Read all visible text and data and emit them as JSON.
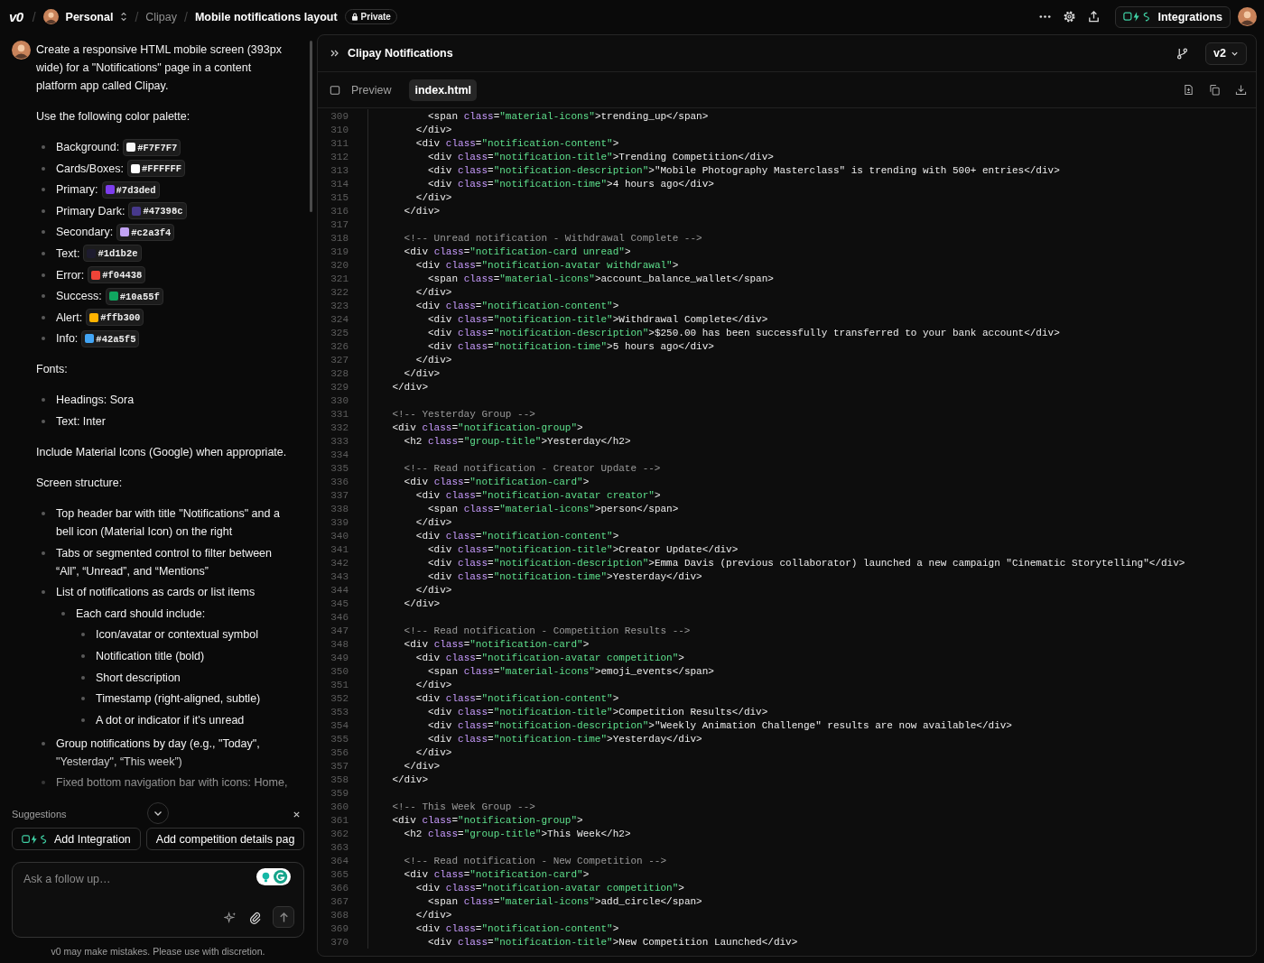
{
  "topbar": {
    "logo": "v0",
    "breadcrumbs": [
      {
        "kind": "account",
        "separator": "/",
        "label": "Personal"
      },
      {
        "kind": "project",
        "separator": "/",
        "label": "Clipay"
      },
      {
        "kind": "chat",
        "separator": "/",
        "label": "Mobile notifications layout"
      }
    ],
    "visibility": "Private",
    "integrations": "Integrations"
  },
  "prompt": {
    "intro": "Create a responsive HTML mobile screen (393px wide) for a \"Notifications\" page in a content platform app called Clipay.",
    "palette_heading": "Use the following color palette:",
    "palette": [
      {
        "label": "Background:",
        "value": "#F7F7F7",
        "color": "#f7f7f7"
      },
      {
        "label": "Cards/Boxes:",
        "value": "#FFFFFF",
        "color": "#ffffff"
      },
      {
        "label": "Primary:",
        "value": "#7d3ded",
        "color": "#7d3ded"
      },
      {
        "label": "Primary Dark:",
        "value": "#47398c",
        "color": "#47398c"
      },
      {
        "label": "Secondary:",
        "value": "#c2a3f4",
        "color": "#c2a3f4"
      },
      {
        "label": "Text:",
        "value": "#1d1b2e",
        "color": "#1d1b2e"
      },
      {
        "label": "Error:",
        "value": "#f04438",
        "color": "#f04438"
      },
      {
        "label": "Success:",
        "value": "#10a55f",
        "color": "#10a55f"
      },
      {
        "label": "Alert:",
        "value": "#ffb300",
        "color": "#ffb300"
      },
      {
        "label": "Info:",
        "value": "#42a5f5",
        "color": "#42a5f5"
      }
    ],
    "fonts_heading": "Fonts:",
    "fonts": [
      "Headings: Sora",
      "Text: Inter"
    ],
    "icons_note": "Include Material Icons (Google) when appropriate.",
    "structure_heading": "Screen structure:",
    "structure": [
      {
        "text": "Top header bar with title \"Notifications\" and a bell icon (Material Icon) on the right"
      },
      {
        "text": "Tabs or segmented control to filter between “All”, “Unread”, and “Mentions”"
      },
      {
        "text": "List of notifications as cards or list items",
        "children": [
          {
            "text": "Each card should include:",
            "children": [
              {
                "text": "Icon/avatar or contextual symbol"
              },
              {
                "text": "Notification title (bold)"
              },
              {
                "text": "Short description"
              },
              {
                "text": "Timestamp (right-aligned, subtle)"
              },
              {
                "text": "A dot or indicator if it's unread"
              }
            ]
          }
        ]
      },
      {
        "text": "Group notifications by day (e.g., \"Today\", \"Yesterday\", “This week”)"
      },
      {
        "text": "Fixed bottom navigation bar with icons: Home,"
      }
    ]
  },
  "suggestions": {
    "title": "Suggestions",
    "chips": [
      {
        "kind": "integration",
        "label": "Add Integration"
      },
      {
        "kind": "plain",
        "label": "Add competition details pag"
      }
    ]
  },
  "composer": {
    "placeholder": "Ask a follow up…"
  },
  "disclaimer": "v0 may make mistakes. Please use with discretion.",
  "editor": {
    "title": "Clipay Notifications",
    "version": "v2",
    "tabs": [
      {
        "kind": "preview",
        "label": "Preview",
        "selected": false
      },
      {
        "kind": "file",
        "label": "index.html",
        "selected": true
      }
    ],
    "lines": [
      {
        "n": "309",
        "parts": [
          {
            "kind": "p",
            "text": "          <span "
          },
          {
            "kind": "a",
            "text": "class"
          },
          {
            "kind": "p",
            "text": "="
          },
          {
            "kind": "s",
            "text": "\"material-icons\""
          },
          {
            "kind": "p",
            "text": ">trending_up</span>"
          }
        ]
      },
      {
        "n": "310",
        "parts": [
          {
            "kind": "p",
            "text": "        </div>"
          }
        ]
      },
      {
        "n": "311",
        "parts": [
          {
            "kind": "p",
            "text": "        <div "
          },
          {
            "kind": "a",
            "text": "class"
          },
          {
            "kind": "p",
            "text": "="
          },
          {
            "kind": "s",
            "text": "\"notification-content\""
          },
          {
            "kind": "p",
            "text": ">"
          }
        ]
      },
      {
        "n": "312",
        "parts": [
          {
            "kind": "p",
            "text": "          <div "
          },
          {
            "kind": "a",
            "text": "class"
          },
          {
            "kind": "p",
            "text": "="
          },
          {
            "kind": "s",
            "text": "\"notification-title\""
          },
          {
            "kind": "p",
            "text": ">Trending Competition</div>"
          }
        ]
      },
      {
        "n": "313",
        "parts": [
          {
            "kind": "p",
            "text": "          <div "
          },
          {
            "kind": "a",
            "text": "class"
          },
          {
            "kind": "p",
            "text": "="
          },
          {
            "kind": "s",
            "text": "\"notification-description\""
          },
          {
            "kind": "p",
            "text": ">\"Mobile Photography Masterclass\" is trending with 500+ entries</div>"
          }
        ]
      },
      {
        "n": "314",
        "parts": [
          {
            "kind": "p",
            "text": "          <div "
          },
          {
            "kind": "a",
            "text": "class"
          },
          {
            "kind": "p",
            "text": "="
          },
          {
            "kind": "s",
            "text": "\"notification-time\""
          },
          {
            "kind": "p",
            "text": ">4 hours ago</div>"
          }
        ]
      },
      {
        "n": "315",
        "parts": [
          {
            "kind": "p",
            "text": "        </div>"
          }
        ]
      },
      {
        "n": "316",
        "parts": [
          {
            "kind": "p",
            "text": "      </div>"
          }
        ]
      },
      {
        "n": "317"
      },
      {
        "n": "318",
        "parts": [
          {
            "kind": "c",
            "text": "      <!-- Unread notification - Withdrawal Complete -->"
          }
        ]
      },
      {
        "n": "319",
        "parts": [
          {
            "kind": "p",
            "text": "      <div "
          },
          {
            "kind": "a",
            "text": "class"
          },
          {
            "kind": "p",
            "text": "="
          },
          {
            "kind": "s",
            "text": "\"notification-card unread\""
          },
          {
            "kind": "p",
            "text": ">"
          }
        ]
      },
      {
        "n": "320",
        "parts": [
          {
            "kind": "p",
            "text": "        <div "
          },
          {
            "kind": "a",
            "text": "class"
          },
          {
            "kind": "p",
            "text": "="
          },
          {
            "kind": "s",
            "text": "\"notification-avatar withdrawal\""
          },
          {
            "kind": "p",
            "text": ">"
          }
        ]
      },
      {
        "n": "321",
        "parts": [
          {
            "kind": "p",
            "text": "          <span "
          },
          {
            "kind": "a",
            "text": "class"
          },
          {
            "kind": "p",
            "text": "="
          },
          {
            "kind": "s",
            "text": "\"material-icons\""
          },
          {
            "kind": "p",
            "text": ">account_balance_wallet</span>"
          }
        ]
      },
      {
        "n": "322",
        "parts": [
          {
            "kind": "p",
            "text": "        </div>"
          }
        ]
      },
      {
        "n": "323",
        "parts": [
          {
            "kind": "p",
            "text": "        <div "
          },
          {
            "kind": "a",
            "text": "class"
          },
          {
            "kind": "p",
            "text": "="
          },
          {
            "kind": "s",
            "text": "\"notification-content\""
          },
          {
            "kind": "p",
            "text": ">"
          }
        ]
      },
      {
        "n": "324",
        "parts": [
          {
            "kind": "p",
            "text": "          <div "
          },
          {
            "kind": "a",
            "text": "class"
          },
          {
            "kind": "p",
            "text": "="
          },
          {
            "kind": "s",
            "text": "\"notification-title\""
          },
          {
            "kind": "p",
            "text": ">Withdrawal Complete</div>"
          }
        ]
      },
      {
        "n": "325",
        "parts": [
          {
            "kind": "p",
            "text": "          <div "
          },
          {
            "kind": "a",
            "text": "class"
          },
          {
            "kind": "p",
            "text": "="
          },
          {
            "kind": "s",
            "text": "\"notification-description\""
          },
          {
            "kind": "p",
            "text": ">$250.00 has been successfully transferred to your bank account</div>"
          }
        ]
      },
      {
        "n": "326",
        "parts": [
          {
            "kind": "p",
            "text": "          <div "
          },
          {
            "kind": "a",
            "text": "class"
          },
          {
            "kind": "p",
            "text": "="
          },
          {
            "kind": "s",
            "text": "\"notification-time\""
          },
          {
            "kind": "p",
            "text": ">5 hours ago</div>"
          }
        ]
      },
      {
        "n": "327",
        "parts": [
          {
            "kind": "p",
            "text": "        </div>"
          }
        ]
      },
      {
        "n": "328",
        "parts": [
          {
            "kind": "p",
            "text": "      </div>"
          }
        ]
      },
      {
        "n": "329",
        "parts": [
          {
            "kind": "p",
            "text": "    </div>"
          }
        ]
      },
      {
        "n": "330"
      },
      {
        "n": "331",
        "parts": [
          {
            "kind": "c",
            "text": "    <!-- Yesterday Group -->"
          }
        ]
      },
      {
        "n": "332",
        "parts": [
          {
            "kind": "p",
            "text": "    <div "
          },
          {
            "kind": "a",
            "text": "class"
          },
          {
            "kind": "p",
            "text": "="
          },
          {
            "kind": "s",
            "text": "\"notification-group\""
          },
          {
            "kind": "p",
            "text": ">"
          }
        ]
      },
      {
        "n": "333",
        "parts": [
          {
            "kind": "p",
            "text": "      <h2 "
          },
          {
            "kind": "a",
            "text": "class"
          },
          {
            "kind": "p",
            "text": "="
          },
          {
            "kind": "s",
            "text": "\"group-title\""
          },
          {
            "kind": "p",
            "text": ">Yesterday</h2>"
          }
        ]
      },
      {
        "n": "334"
      },
      {
        "n": "335",
        "parts": [
          {
            "kind": "c",
            "text": "      <!-- Read notification - Creator Update -->"
          }
        ]
      },
      {
        "n": "336",
        "parts": [
          {
            "kind": "p",
            "text": "      <div "
          },
          {
            "kind": "a",
            "text": "class"
          },
          {
            "kind": "p",
            "text": "="
          },
          {
            "kind": "s",
            "text": "\"notification-card\""
          },
          {
            "kind": "p",
            "text": ">"
          }
        ]
      },
      {
        "n": "337",
        "parts": [
          {
            "kind": "p",
            "text": "        <div "
          },
          {
            "kind": "a",
            "text": "class"
          },
          {
            "kind": "p",
            "text": "="
          },
          {
            "kind": "s",
            "text": "\"notification-avatar creator\""
          },
          {
            "kind": "p",
            "text": ">"
          }
        ]
      },
      {
        "n": "338",
        "parts": [
          {
            "kind": "p",
            "text": "          <span "
          },
          {
            "kind": "a",
            "text": "class"
          },
          {
            "kind": "p",
            "text": "="
          },
          {
            "kind": "s",
            "text": "\"material-icons\""
          },
          {
            "kind": "p",
            "text": ">person</span>"
          }
        ]
      },
      {
        "n": "339",
        "parts": [
          {
            "kind": "p",
            "text": "        </div>"
          }
        ]
      },
      {
        "n": "340",
        "parts": [
          {
            "kind": "p",
            "text": "        <div "
          },
          {
            "kind": "a",
            "text": "class"
          },
          {
            "kind": "p",
            "text": "="
          },
          {
            "kind": "s",
            "text": "\"notification-content\""
          },
          {
            "kind": "p",
            "text": ">"
          }
        ]
      },
      {
        "n": "341",
        "parts": [
          {
            "kind": "p",
            "text": "          <div "
          },
          {
            "kind": "a",
            "text": "class"
          },
          {
            "kind": "p",
            "text": "="
          },
          {
            "kind": "s",
            "text": "\"notification-title\""
          },
          {
            "kind": "p",
            "text": ">Creator Update</div>"
          }
        ]
      },
      {
        "n": "342",
        "parts": [
          {
            "kind": "p",
            "text": "          <div "
          },
          {
            "kind": "a",
            "text": "class"
          },
          {
            "kind": "p",
            "text": "="
          },
          {
            "kind": "s",
            "text": "\"notification-description\""
          },
          {
            "kind": "p",
            "text": ">Emma Davis (previous collaborator) launched a new campaign \"Cinematic Storytelling\"</div>"
          }
        ]
      },
      {
        "n": "343",
        "parts": [
          {
            "kind": "p",
            "text": "          <div "
          },
          {
            "kind": "a",
            "text": "class"
          },
          {
            "kind": "p",
            "text": "="
          },
          {
            "kind": "s",
            "text": "\"notification-time\""
          },
          {
            "kind": "p",
            "text": ">Yesterday</div>"
          }
        ]
      },
      {
        "n": "344",
        "parts": [
          {
            "kind": "p",
            "text": "        </div>"
          }
        ]
      },
      {
        "n": "345",
        "parts": [
          {
            "kind": "p",
            "text": "      </div>"
          }
        ]
      },
      {
        "n": "346"
      },
      {
        "n": "347",
        "parts": [
          {
            "kind": "c",
            "text": "      <!-- Read notification - Competition Results -->"
          }
        ]
      },
      {
        "n": "348",
        "parts": [
          {
            "kind": "p",
            "text": "      <div "
          },
          {
            "kind": "a",
            "text": "class"
          },
          {
            "kind": "p",
            "text": "="
          },
          {
            "kind": "s",
            "text": "\"notification-card\""
          },
          {
            "kind": "p",
            "text": ">"
          }
        ]
      },
      {
        "n": "349",
        "parts": [
          {
            "kind": "p",
            "text": "        <div "
          },
          {
            "kind": "a",
            "text": "class"
          },
          {
            "kind": "p",
            "text": "="
          },
          {
            "kind": "s",
            "text": "\"notification-avatar competition\""
          },
          {
            "kind": "p",
            "text": ">"
          }
        ]
      },
      {
        "n": "350",
        "parts": [
          {
            "kind": "p",
            "text": "          <span "
          },
          {
            "kind": "a",
            "text": "class"
          },
          {
            "kind": "p",
            "text": "="
          },
          {
            "kind": "s",
            "text": "\"material-icons\""
          },
          {
            "kind": "p",
            "text": ">emoji_events</span>"
          }
        ]
      },
      {
        "n": "351",
        "parts": [
          {
            "kind": "p",
            "text": "        </div>"
          }
        ]
      },
      {
        "n": "352",
        "parts": [
          {
            "kind": "p",
            "text": "        <div "
          },
          {
            "kind": "a",
            "text": "class"
          },
          {
            "kind": "p",
            "text": "="
          },
          {
            "kind": "s",
            "text": "\"notification-content\""
          },
          {
            "kind": "p",
            "text": ">"
          }
        ]
      },
      {
        "n": "353",
        "parts": [
          {
            "kind": "p",
            "text": "          <div "
          },
          {
            "kind": "a",
            "text": "class"
          },
          {
            "kind": "p",
            "text": "="
          },
          {
            "kind": "s",
            "text": "\"notification-title\""
          },
          {
            "kind": "p",
            "text": ">Competition Results</div>"
          }
        ]
      },
      {
        "n": "354",
        "parts": [
          {
            "kind": "p",
            "text": "          <div "
          },
          {
            "kind": "a",
            "text": "class"
          },
          {
            "kind": "p",
            "text": "="
          },
          {
            "kind": "s",
            "text": "\"notification-description\""
          },
          {
            "kind": "p",
            "text": ">\"Weekly Animation Challenge\" results are now available</div>"
          }
        ]
      },
      {
        "n": "355",
        "parts": [
          {
            "kind": "p",
            "text": "          <div "
          },
          {
            "kind": "a",
            "text": "class"
          },
          {
            "kind": "p",
            "text": "="
          },
          {
            "kind": "s",
            "text": "\"notification-time\""
          },
          {
            "kind": "p",
            "text": ">Yesterday</div>"
          }
        ]
      },
      {
        "n": "356",
        "parts": [
          {
            "kind": "p",
            "text": "        </div>"
          }
        ]
      },
      {
        "n": "357",
        "parts": [
          {
            "kind": "p",
            "text": "      </div>"
          }
        ]
      },
      {
        "n": "358",
        "parts": [
          {
            "kind": "p",
            "text": "    </div>"
          }
        ]
      },
      {
        "n": "359"
      },
      {
        "n": "360",
        "parts": [
          {
            "kind": "c",
            "text": "    <!-- This Week Group -->"
          }
        ]
      },
      {
        "n": "361",
        "parts": [
          {
            "kind": "p",
            "text": "    <div "
          },
          {
            "kind": "a",
            "text": "class"
          },
          {
            "kind": "p",
            "text": "="
          },
          {
            "kind": "s",
            "text": "\"notification-group\""
          },
          {
            "kind": "p",
            "text": ">"
          }
        ]
      },
      {
        "n": "362",
        "parts": [
          {
            "kind": "p",
            "text": "      <h2 "
          },
          {
            "kind": "a",
            "text": "class"
          },
          {
            "kind": "p",
            "text": "="
          },
          {
            "kind": "s",
            "text": "\"group-title\""
          },
          {
            "kind": "p",
            "text": ">This Week</h2>"
          }
        ]
      },
      {
        "n": "363"
      },
      {
        "n": "364",
        "parts": [
          {
            "kind": "c",
            "text": "      <!-- Read notification - New Competition -->"
          }
        ]
      },
      {
        "n": "365",
        "parts": [
          {
            "kind": "p",
            "text": "      <div "
          },
          {
            "kind": "a",
            "text": "class"
          },
          {
            "kind": "p",
            "text": "="
          },
          {
            "kind": "s",
            "text": "\"notification-card\""
          },
          {
            "kind": "p",
            "text": ">"
          }
        ]
      },
      {
        "n": "366",
        "parts": [
          {
            "kind": "p",
            "text": "        <div "
          },
          {
            "kind": "a",
            "text": "class"
          },
          {
            "kind": "p",
            "text": "="
          },
          {
            "kind": "s",
            "text": "\"notification-avatar competition\""
          },
          {
            "kind": "p",
            "text": ">"
          }
        ]
      },
      {
        "n": "367",
        "parts": [
          {
            "kind": "p",
            "text": "          <span "
          },
          {
            "kind": "a",
            "text": "class"
          },
          {
            "kind": "p",
            "text": "="
          },
          {
            "kind": "s",
            "text": "\"material-icons\""
          },
          {
            "kind": "p",
            "text": ">add_circle</span>"
          }
        ]
      },
      {
        "n": "368",
        "parts": [
          {
            "kind": "p",
            "text": "        </div>"
          }
        ]
      },
      {
        "n": "369",
        "parts": [
          {
            "kind": "p",
            "text": "        <div "
          },
          {
            "kind": "a",
            "text": "class"
          },
          {
            "kind": "p",
            "text": "="
          },
          {
            "kind": "s",
            "text": "\"notification-content\""
          },
          {
            "kind": "p",
            "text": ">"
          }
        ]
      },
      {
        "n": "370",
        "parts": [
          {
            "kind": "p",
            "text": "          <div "
          },
          {
            "kind": "a",
            "text": "class"
          },
          {
            "kind": "p",
            "text": "="
          },
          {
            "kind": "s",
            "text": "\"notification-title\""
          },
          {
            "kind": "p",
            "text": ">New Competition Launched</div>"
          }
        ]
      }
    ]
  }
}
